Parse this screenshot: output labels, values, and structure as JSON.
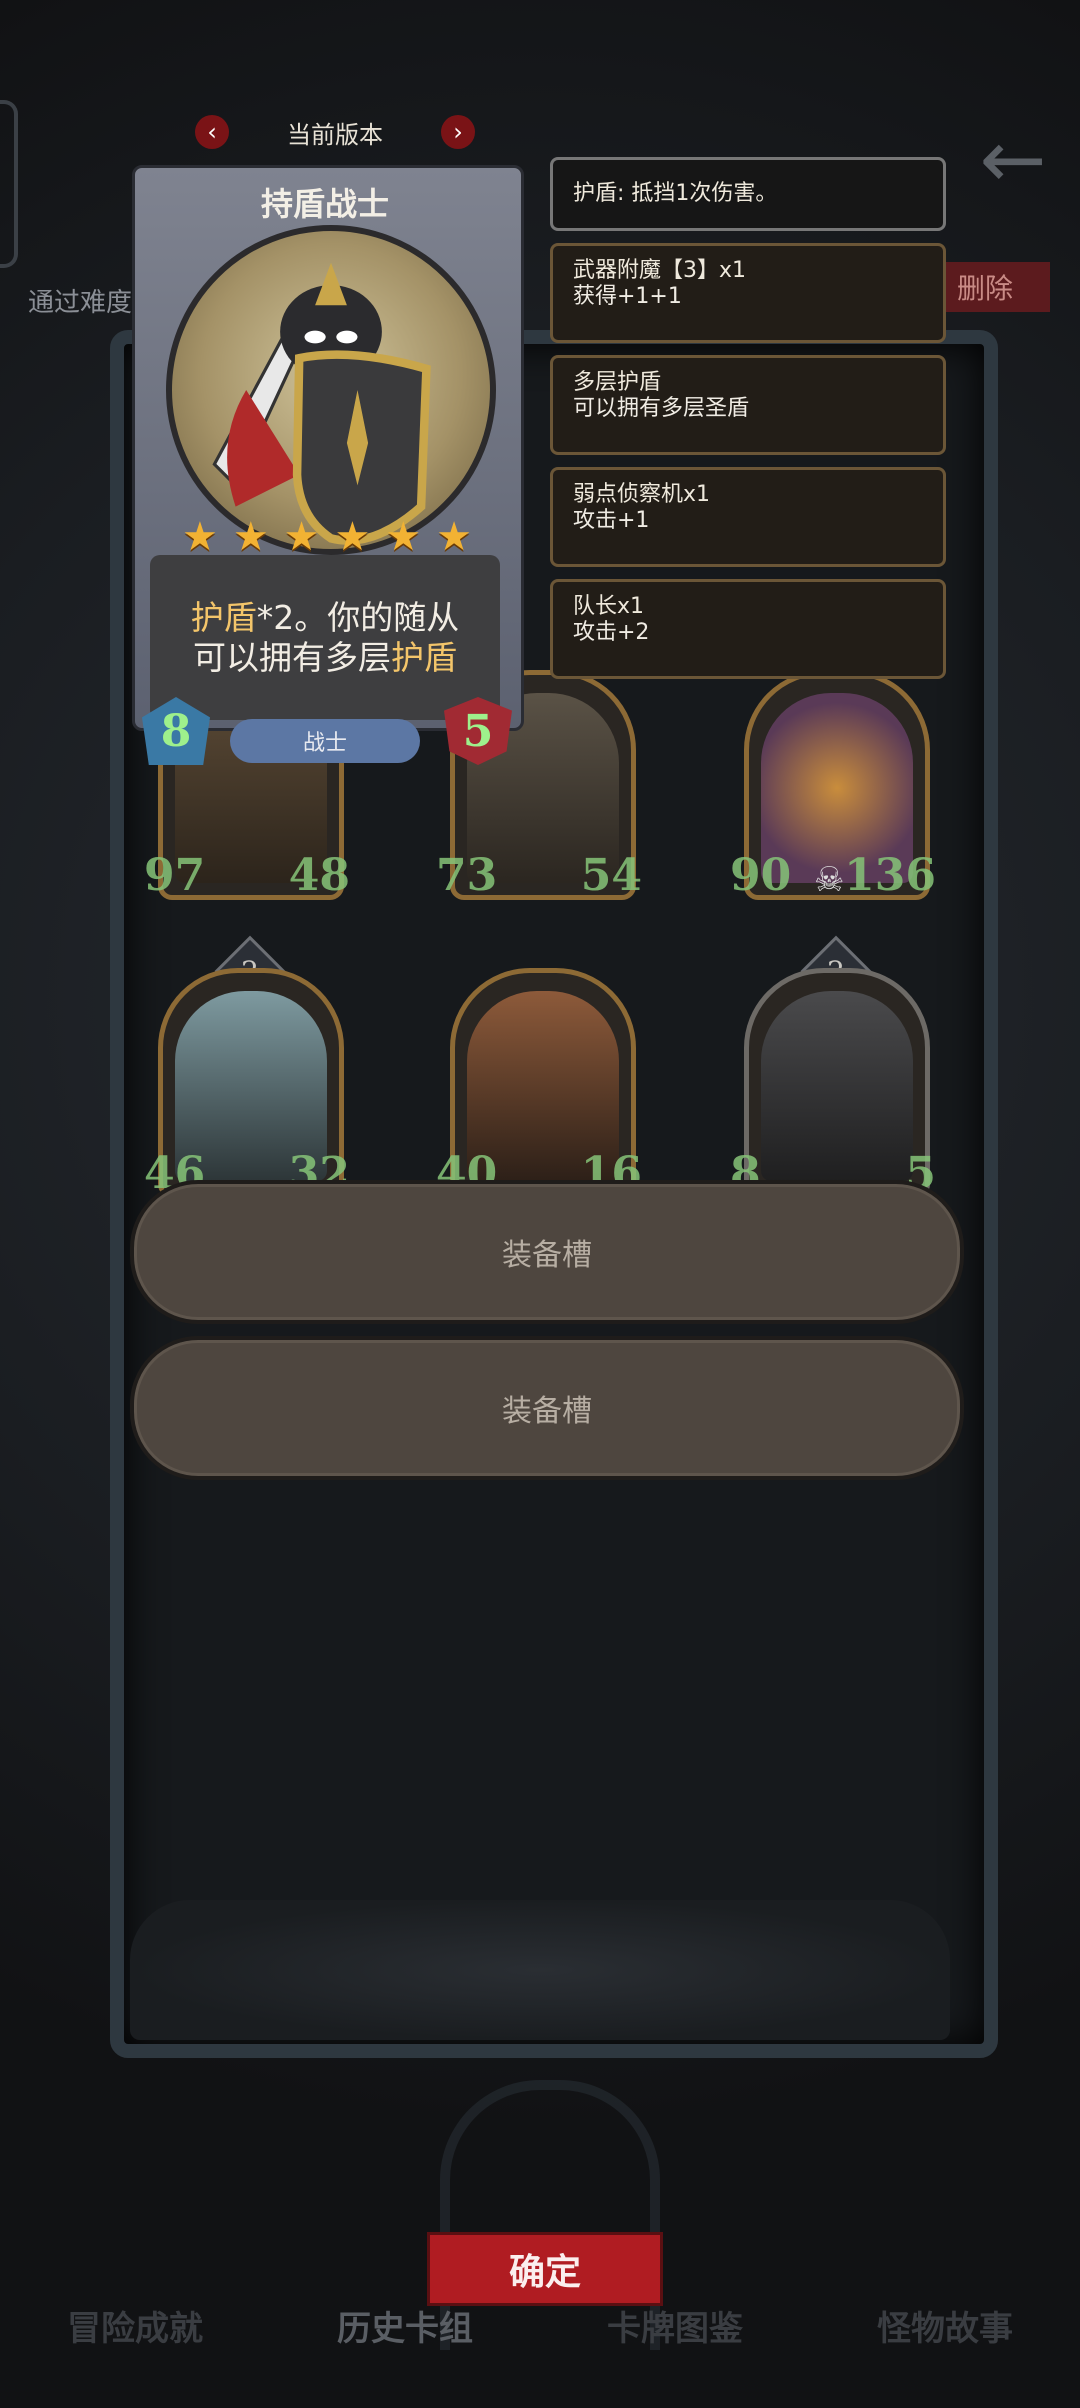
{
  "header": {
    "version_label": "当前版本",
    "prev_icon": "chevron-left-icon",
    "next_icon": "chevron-right-icon",
    "side_text": "通过难度",
    "delete_label": "删除"
  },
  "card": {
    "name": "持盾战士",
    "stars": 6,
    "description_parts": [
      "护盾",
      "*2。你的随从",
      "可以拥有多层",
      "护盾"
    ],
    "class_label": "战士",
    "attack": "8",
    "health": "5"
  },
  "effects": [
    {
      "name": "护盾: 抵挡1次伤害。",
      "desc": ""
    },
    {
      "name": "武器附魔【3】x1",
      "desc": "获得+1+1"
    },
    {
      "name": "多层护盾",
      "desc": "可以拥有多层圣盾"
    },
    {
      "name": "弱点侦察机x1",
      "desc": "攻击+1"
    },
    {
      "name": "队长x1",
      "desc": "攻击+2"
    }
  ],
  "minions": [
    {
      "attack": "97",
      "health": "48",
      "cost": ""
    },
    {
      "attack": "73",
      "health": "54",
      "cost": ""
    },
    {
      "attack": "90",
      "health": "136",
      "cost": ""
    },
    {
      "attack": "46",
      "health": "32",
      "cost": "2"
    },
    {
      "attack": "40",
      "health": "16",
      "cost": ""
    },
    {
      "attack": "8",
      "health": "5",
      "cost": "2"
    }
  ],
  "slots": [
    "装备槽",
    "装备槽"
  ],
  "confirm_label": "确定",
  "bottom_nav": [
    "冒险成就",
    "历史卡组",
    "卡牌图鉴",
    "怪物故事"
  ],
  "colors": {
    "accent_red": "#b01c22",
    "highlight": "#f3c56a",
    "stat_green": "#9ef08c"
  }
}
